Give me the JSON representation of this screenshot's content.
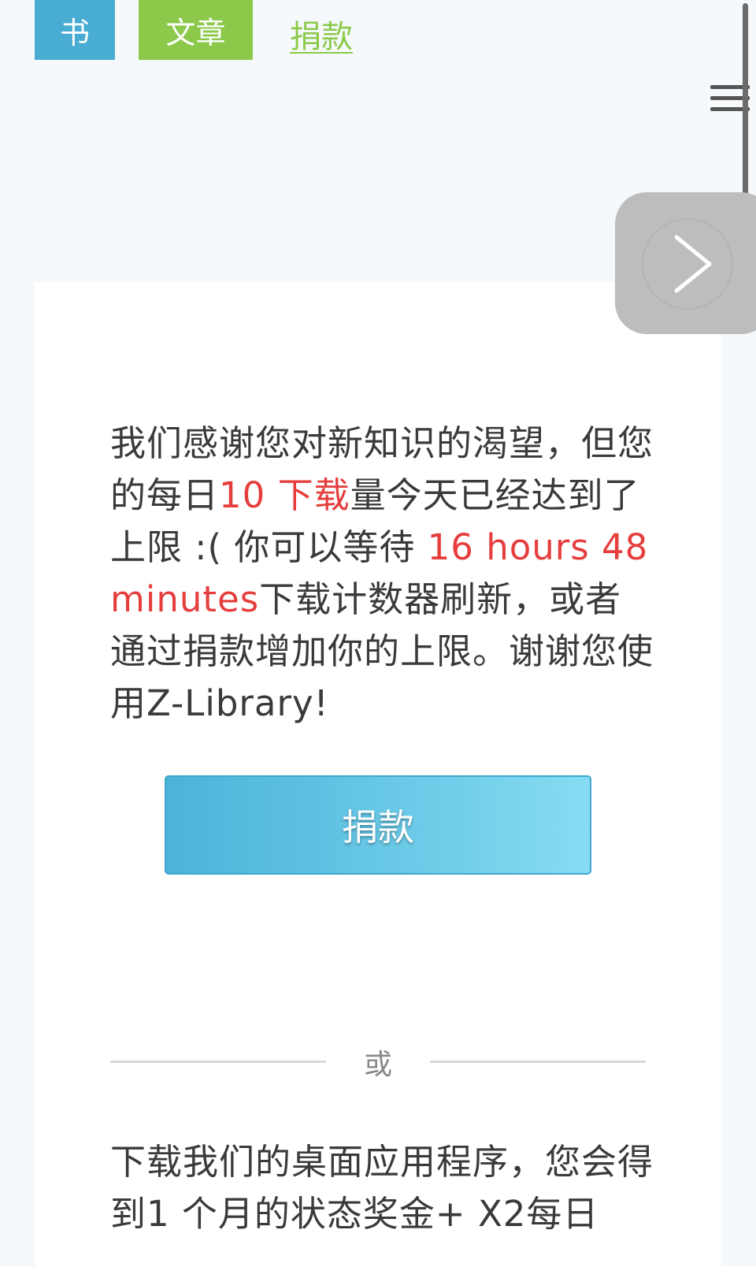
{
  "nav": {
    "books_label": "书",
    "articles_label": "文章",
    "donate_link": "捐款"
  },
  "limit_message": {
    "part1": "我们感谢您对新知识的渴望，但您的每日",
    "limit_highlight": "10 下载",
    "part2": "量今天已经达到了上限 :( 你可以等待 ",
    "time_highlight": "16 hours 48 minutes",
    "part3": "下载计数器刷新，或者通过捐款增加你的上限。谢谢您使用Z-Library!"
  },
  "donate_button": "捐款",
  "divider_text": "或",
  "desktop_app_text": "下载我们的桌面应用程序，您会得到1 个月的状态奖金+ X2每日",
  "colors": {
    "books_tab": "#49acd2",
    "articles_tab": "#8cc94b",
    "highlight_red": "#e63d3d",
    "button_blue": "#4cb3d8"
  },
  "icons": {
    "menu": "hamburger-menu-icon",
    "next": "chevron-right-icon"
  }
}
